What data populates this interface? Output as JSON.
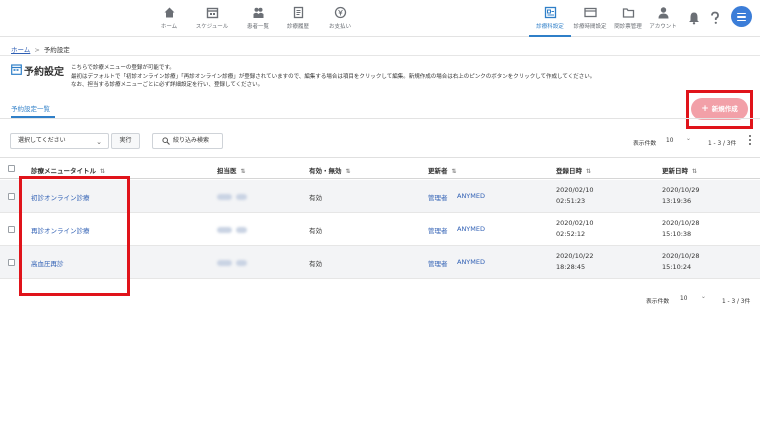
{
  "nav": {
    "items": [
      {
        "label": "ホーム"
      },
      {
        "label": "スケジュール"
      },
      {
        "label": "患者一覧"
      },
      {
        "label": "診療履歴"
      },
      {
        "label": "お支払い"
      }
    ],
    "right_items": [
      {
        "label": "診療科設定",
        "active": true
      },
      {
        "label": "診療時間設定"
      },
      {
        "label": "問診票管理"
      },
      {
        "label": "アカウント"
      }
    ]
  },
  "breadcrumb": {
    "home": "ホーム",
    "sep": ">",
    "current": "予約設定"
  },
  "page": {
    "title": "予約設定",
    "desc": [
      "こちらで診療メニューの登録が可能です。",
      "最初はデフォルトで「初診オンライン診療」「再診オンライン診療」が登録されていますので、編集する場合は項目をクリックして編集。新規作成の場合は右上のピンクのボタンをクリックして作成してください。",
      "なお、担当する診療メニューごとに必ず詳細設定を行い、登録してください。"
    ]
  },
  "tab": {
    "label": "予約設定一覧"
  },
  "new_button": {
    "icon": "+",
    "label": "新規作成"
  },
  "toolbar": {
    "select_value": "選択してください",
    "execute": "実行",
    "filter": "絞り込み検索",
    "per_page_label": "表示件数",
    "per_page": "10",
    "range": "1 - 3 / 3件"
  },
  "table": {
    "headers": [
      "診療メニュータイトル",
      "担当医",
      "有効・無効",
      "更新者",
      "登録日時",
      "更新日時"
    ],
    "rows": [
      {
        "title": "初診オンライン診療",
        "status": "有効",
        "updater_role": "管理者",
        "updater": "ANYMED",
        "created_date": "2020/02/10",
        "created_time": "02:51:23",
        "updated_date": "2020/10/29",
        "updated_time": "13:19:36"
      },
      {
        "title": "再診オンライン診療",
        "status": "有効",
        "updater_role": "管理者",
        "updater": "ANYMED",
        "created_date": "2020/02/10",
        "created_time": "02:52:12",
        "updated_date": "2020/10/28",
        "updated_time": "15:10:38"
      },
      {
        "title": "高血圧再診",
        "status": "有効",
        "updater_role": "管理者",
        "updater": "ANYMED",
        "created_date": "2020/10/22",
        "created_time": "18:28:45",
        "updated_date": "2020/10/28",
        "updated_time": "15:10:24"
      }
    ]
  },
  "footer": {
    "per_page_label": "表示件数",
    "per_page": "10",
    "range": "1 - 3 / 3件"
  },
  "colors": {
    "accent": "#2f7fc8",
    "link": "#2f5fb4",
    "new_button": "#f2a0a8",
    "highlight": "#e0131a"
  },
  "icons": [
    "home-icon",
    "calendar-icon",
    "users-icon",
    "history-icon",
    "yen-icon",
    "clinic-settings-icon",
    "schedule-settings-icon",
    "folder-icon",
    "account-icon",
    "bell-icon",
    "help-icon",
    "menu-icon",
    "page-icon",
    "search-icon"
  ]
}
